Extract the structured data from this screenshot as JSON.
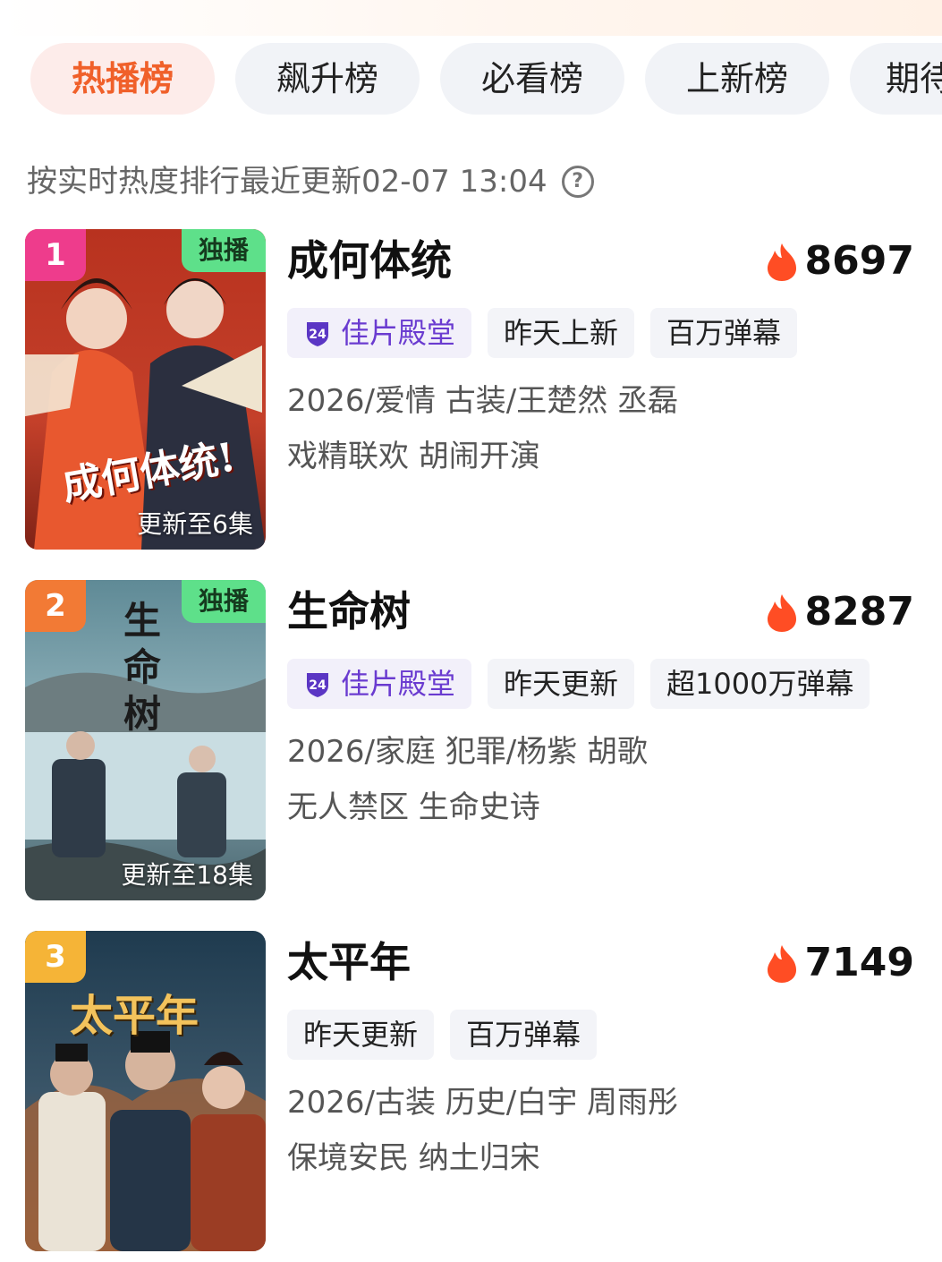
{
  "tabs": [
    {
      "label": "热播榜",
      "active": true
    },
    {
      "label": "飙升榜",
      "active": false
    },
    {
      "label": "必看榜",
      "active": false
    },
    {
      "label": "上新榜",
      "active": false
    },
    {
      "label": "期待",
      "active": false
    }
  ],
  "subtitle": "按实时热度排行最近更新02-07 13:04",
  "help_icon": "?",
  "items": [
    {
      "rank": "1",
      "rank_color": "#ee3c8c",
      "exclusive": "独播",
      "update": "更新至6集",
      "title": "成何体统",
      "heat": "8697",
      "tags": [
        "佳片殿堂",
        "昨天上新",
        "百万弹幕"
      ],
      "meta1": "2026/爱情 古装/王楚然 丞磊",
      "meta2": "戏精联欢 胡闹开演",
      "poster_title": "成何体统!"
    },
    {
      "rank": "2",
      "rank_color": "#f27a35",
      "exclusive": "独播",
      "update": "更新至18集",
      "title": "生命树",
      "heat": "8287",
      "tags": [
        "佳片殿堂",
        "昨天更新",
        "超1000万弹幕"
      ],
      "meta1": "2026/家庭 犯罪/杨紫 胡歌",
      "meta2": "无人禁区 生命史诗",
      "poster_title": "生命树"
    },
    {
      "rank": "3",
      "rank_color": "#f5b437",
      "exclusive": "",
      "update": "",
      "title": "太平年",
      "heat": "7149",
      "tags": [
        "昨天更新",
        "百万弹幕"
      ],
      "meta1": "2026/古装 历史/白宇 周雨彤",
      "meta2": "保境安民 纳土归宋",
      "poster_title": "太平年"
    }
  ],
  "icons": {
    "heat": "flame-icon",
    "premium": "premium-shield-icon"
  }
}
